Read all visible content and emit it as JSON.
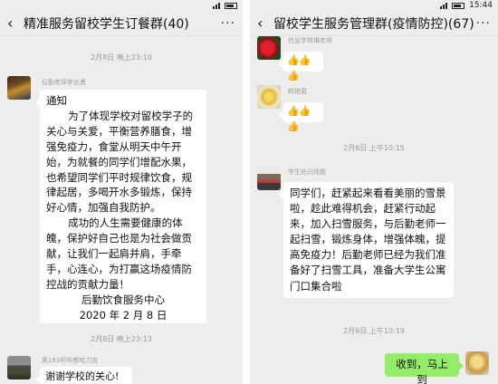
{
  "left": {
    "status": {
      "time": ""
    },
    "title": "精准服务留校学生订餐群(40)",
    "timestamp1": "2月8日 晚上23:10",
    "sender1": "后勤老师李志勇",
    "notice": {
      "heading": "通知",
      "para1": "为了体现学校对留校学子的关心与关爱，平衡营养膳食，增强免疫力，食堂从明天中午开始，为就餐的同学们增配水果，也希望同学们平时规律饮食，规律起居，多喝开水多锻炼，保持好心情，加强自我防护。",
      "para2": "成功的人生需要健康的体魄，保护好自己也是为社会做贡献，让我们一起肩并肩，手牵手，心连心，为打赢这场疫情防控战的贡献力量！",
      "sign_org": "后勤饮食服务中心",
      "sign_date": "2020 年 2 月 8 日"
    },
    "timestamp2": "2月8日 晚上23:13",
    "sender2": "奥163阿布都哈力克",
    "message2": "谢谢学校的关心!"
  },
  "right": {
    "status": {
      "time": "15:44"
    },
    "title": "留校学生服务管理群(疫情防控)(67)",
    "sender1": "信息学林琳老师",
    "thumbs1": "👍👍👍",
    "sender2": "韩艳君",
    "thumbs2": "👍👍👍",
    "timestamp1": "2月6日 上午10:15",
    "sender3": "学生处闫伟歌",
    "snow_message": "同学们，赶紧起来看看美丽的雪景啦，趁此难得机会，赶紧行动起来，加入扫雪服务，与后勤老师一起扫雪，锻炼身体，增强体魄，提高免疫力！后勤老师已经为我们准备好了扫雪工具，准备大学生公寓门口集合啦",
    "timestamp2": "2月6日 上午10:19",
    "reply": "收到，马上到"
  },
  "icons": {
    "back": "chevron-left-icon",
    "more": "more-dots-icon"
  }
}
